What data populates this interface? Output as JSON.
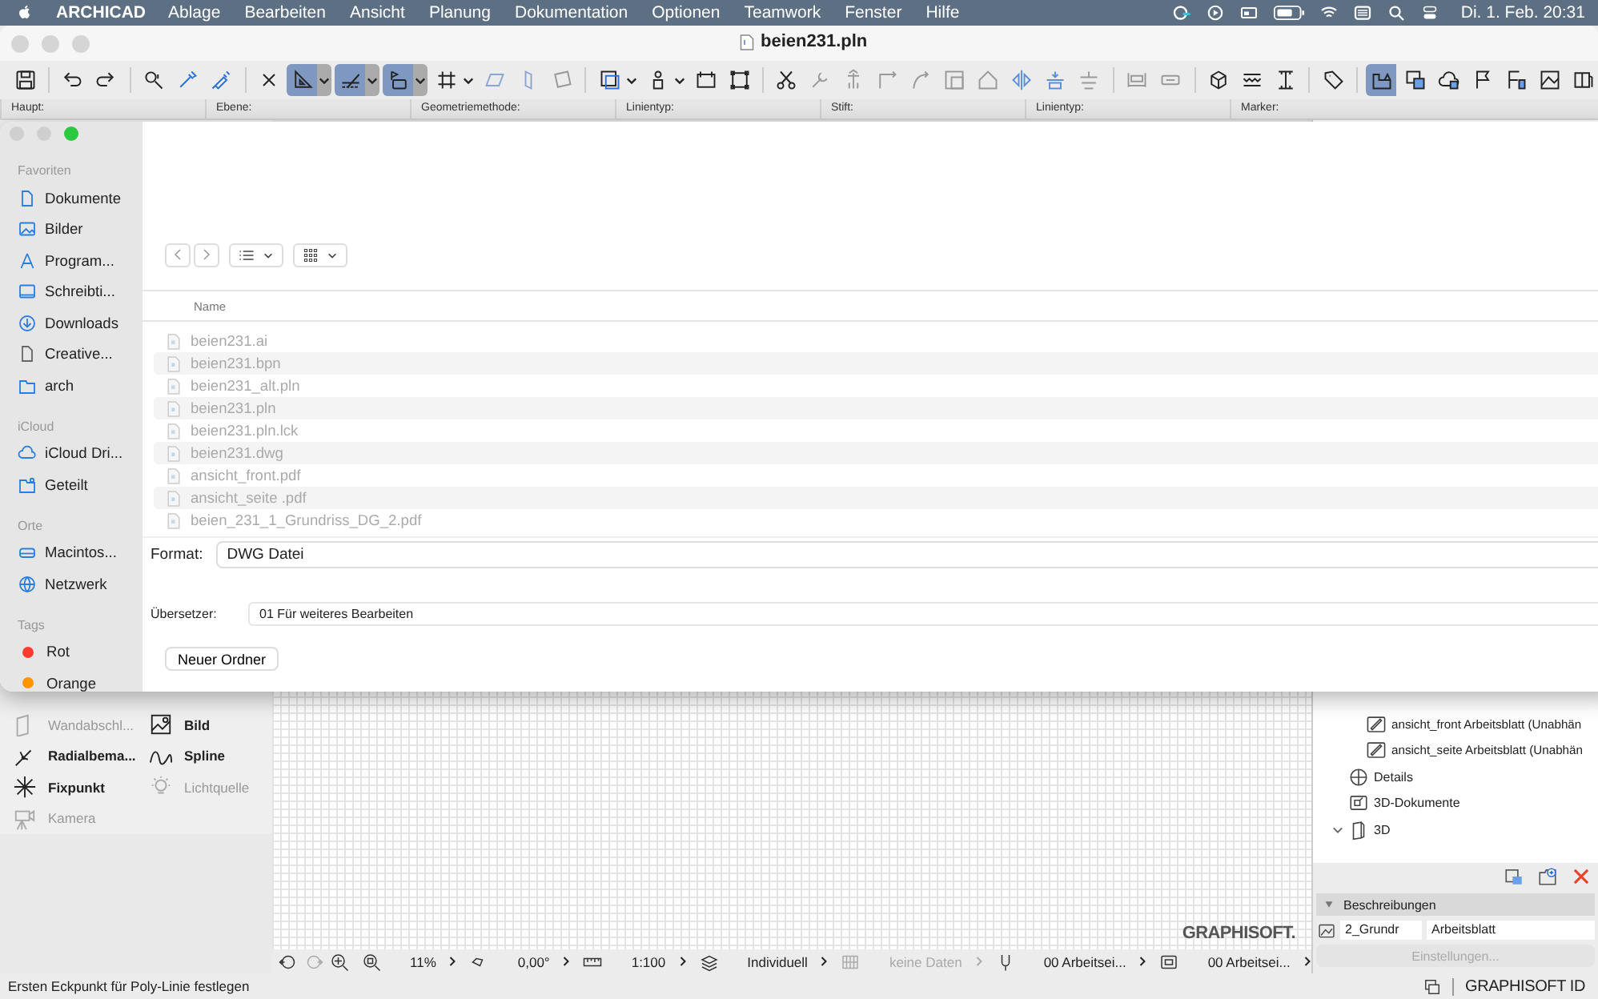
{
  "menu_bar": {
    "app": "ARCHICAD",
    "items": [
      "Ablage",
      "Bearbeiten",
      "Ansicht",
      "Planung",
      "Dokumentation",
      "Optionen",
      "Teamwork",
      "Fenster",
      "Hilfe"
    ],
    "clock": "Di. 1. Feb.  20:31"
  },
  "window": {
    "title": "beien231.pln"
  },
  "toolbar": {
    "buttons": [
      {
        "active": false
      },
      {
        "active": false
      },
      {
        "active": false
      },
      {
        "active": false
      },
      {
        "active": false
      },
      {
        "active": false
      },
      {
        "active": false
      },
      {
        "active": true
      },
      {
        "active": true
      },
      {
        "active": true
      },
      {
        "active": false
      },
      {
        "active": false
      },
      {
        "active": false
      },
      {
        "active": false
      },
      {
        "active": false
      },
      {
        "active": false
      },
      {
        "active": false
      },
      {
        "active": false
      },
      {
        "active": false
      },
      {
        "active": false
      },
      {
        "active": false
      },
      {
        "active": false
      },
      {
        "active": false
      },
      {
        "active": false
      },
      {
        "active": false
      },
      {
        "active": false
      },
      {
        "active": false
      },
      {
        "active": false
      },
      {
        "active": false
      },
      {
        "active": false
      },
      {
        "active": false
      },
      {
        "active": false
      },
      {
        "active": false
      },
      {
        "active": false
      },
      {
        "active": true
      },
      {
        "active": false
      },
      {
        "active": false
      },
      {
        "active": false
      },
      {
        "active": false
      },
      {
        "active": false
      },
      {
        "active": false
      }
    ]
  },
  "info_box": {
    "labels": [
      "Haupt:",
      "Ebene:",
      "Geometriemethode:",
      "Linientyp:",
      "Stift:",
      "Linientyp:",
      "Marker:"
    ]
  },
  "toolbox": {
    "items": [
      {
        "label": "Wandabschl...",
        "disabled": true
      },
      {
        "label": "Bild",
        "disabled": false
      },
      {
        "label": "Radialbema...",
        "disabled": false
      },
      {
        "label": "Spline",
        "disabled": false
      },
      {
        "label": "Fixpunkt",
        "disabled": false
      },
      {
        "label": "Lichtquelle",
        "disabled": true
      },
      {
        "label": "Kamera",
        "disabled": true
      }
    ]
  },
  "canvas": {
    "logo": "GRAPHISOFT."
  },
  "zoom_bar": {
    "items": [
      {
        "text": "11%",
        "disabled": false
      },
      {
        "text": "0,00°",
        "disabled": false
      },
      {
        "text": "1:100",
        "disabled": false
      },
      {
        "text": "Individuell",
        "disabled": false
      },
      {
        "text": "keine Daten",
        "disabled": true
      },
      {
        "text": "00 Arbeitsei...",
        "disabled": false
      },
      {
        "text": "00 Arbeitsei...",
        "disabled": false
      }
    ]
  },
  "navigator": {
    "worksheets": [
      {
        "label": "ansicht_front Arbeitsblatt (Unabhän"
      },
      {
        "label": "ansicht_seite Arbeitsblatt (Unabhän"
      }
    ],
    "items": [
      {
        "label": "Details"
      },
      {
        "label": "3D-Dokumente"
      },
      {
        "label": "3D",
        "expanded": true
      }
    ],
    "section": {
      "title": "Beschreibungen",
      "expanded": true
    },
    "field_1": "2_Grundr",
    "field_2": "Arbeitsblatt",
    "settings_button": "Einstellungen..."
  },
  "status_bar": {
    "message": "Ersten Eckpunkt für Poly-Linie festlegen",
    "brand": "GRAPHISOFT ID"
  },
  "dialog": {
    "sidebar": [
      {
        "title": "Favoriten",
        "items": [
          {
            "label": "Dokumente"
          },
          {
            "label": "Bilder"
          },
          {
            "label": "Program..."
          },
          {
            "label": "Schreibti..."
          },
          {
            "label": "Downloads"
          },
          {
            "label": "Creative..."
          },
          {
            "label": "arch"
          }
        ]
      },
      {
        "title": "iCloud",
        "items": [
          {
            "label": "iCloud Dri..."
          },
          {
            "label": "Geteilt"
          }
        ]
      },
      {
        "title": "Orte",
        "items": [
          {
            "label": "Macintos..."
          },
          {
            "label": "Netzwerk"
          }
        ]
      },
      {
        "title": "Tags",
        "items": [
          {
            "label": "Rot",
            "color": "#ff3b30"
          },
          {
            "label": "Orange",
            "color": "#ff9500"
          }
        ]
      }
    ],
    "column_header": "Name",
    "files": [
      {
        "name": "beien231.ai",
        "disabled": true
      },
      {
        "name": "beien231.bpn",
        "disabled": true
      },
      {
        "name": "beien231_alt.pln",
        "disabled": true
      },
      {
        "name": "beien231.pln",
        "disabled": true
      },
      {
        "name": "beien231.pln.lck",
        "disabled": true
      },
      {
        "name": "beien231.dwg",
        "disabled": true
      },
      {
        "name": "ansicht_front.pdf",
        "disabled": true
      },
      {
        "name": "ansicht_seite .pdf",
        "disabled": true
      },
      {
        "name": "beien_231_1_Grundriss_DG_2.pdf",
        "disabled": true
      }
    ],
    "format_label": "Format:",
    "format_value": "DWG Datei",
    "translator_label": "Übersetzer:",
    "translator_value": "01 Für weiteres Bearbeiten",
    "new_folder_button": "Neuer Ordner"
  }
}
